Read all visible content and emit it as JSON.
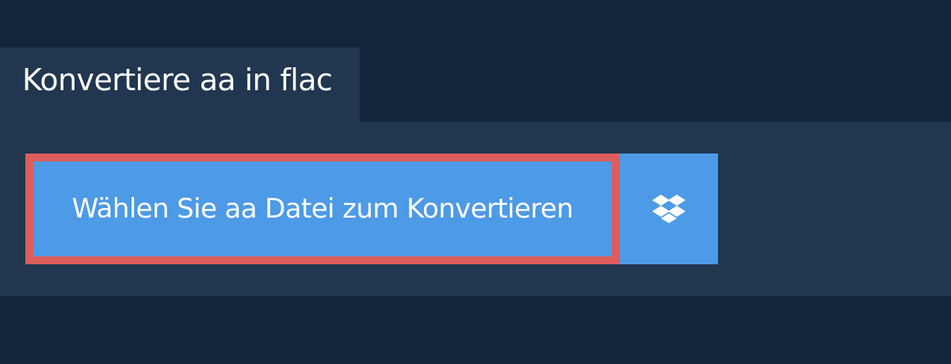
{
  "header": {
    "title": "Konvertiere aa in flac"
  },
  "upload": {
    "choose_file_label": "Wählen Sie aa Datei zum Konvertieren",
    "dropbox_icon": "dropbox-icon"
  },
  "colors": {
    "page_background": "#11253b",
    "panel_background": "#21364f",
    "button_background": "#4d9ae6",
    "button_focus_outline": "#dd5c5c",
    "text": "#ffffff"
  }
}
